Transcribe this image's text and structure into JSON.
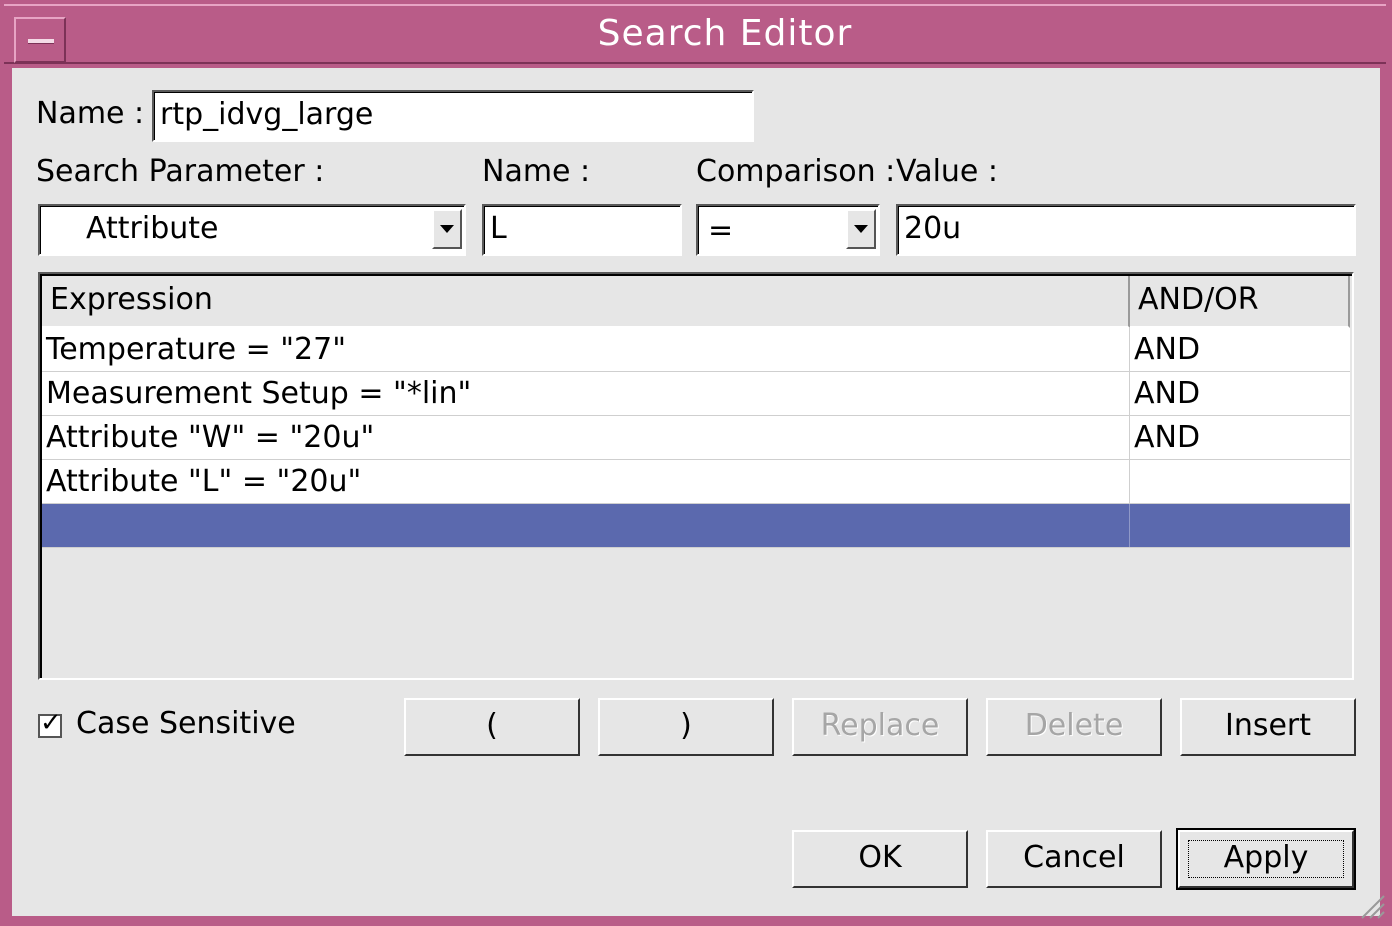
{
  "window": {
    "title": "Search Editor"
  },
  "form": {
    "name_label": "Name :",
    "name_value": "rtp_idvg_large",
    "search_parameter_label": "Search Parameter :",
    "search_parameter_value": "Attribute",
    "param_name_label": "Name :",
    "param_name_value": "L",
    "comparison_label": "Comparison :",
    "comparison_value": "=",
    "value_label": "Value :",
    "value_value": "20u"
  },
  "table": {
    "headers": [
      "Expression",
      "AND/OR"
    ],
    "rows": [
      {
        "expression": "Temperature = \"27\"",
        "andor": "AND"
      },
      {
        "expression": "Measurement Setup = \"*lin\"",
        "andor": "AND"
      },
      {
        "expression": "Attribute \"W\" = \"20u\"",
        "andor": "AND"
      },
      {
        "expression": "Attribute \"L\" = \"20u\"",
        "andor": ""
      },
      {
        "expression": "",
        "andor": ""
      }
    ]
  },
  "options": {
    "case_sensitive_label": "Case Sensitive",
    "case_sensitive_checked": true
  },
  "buttons": {
    "open_paren": "(",
    "close_paren": ")",
    "replace": "Replace",
    "delete": "Delete",
    "insert": "Insert",
    "ok": "OK",
    "cancel": "Cancel",
    "apply": "Apply"
  },
  "colors": {
    "titlebar": "#b95c88",
    "selection": "#5b69ae",
    "background": "#e6e6e6"
  }
}
